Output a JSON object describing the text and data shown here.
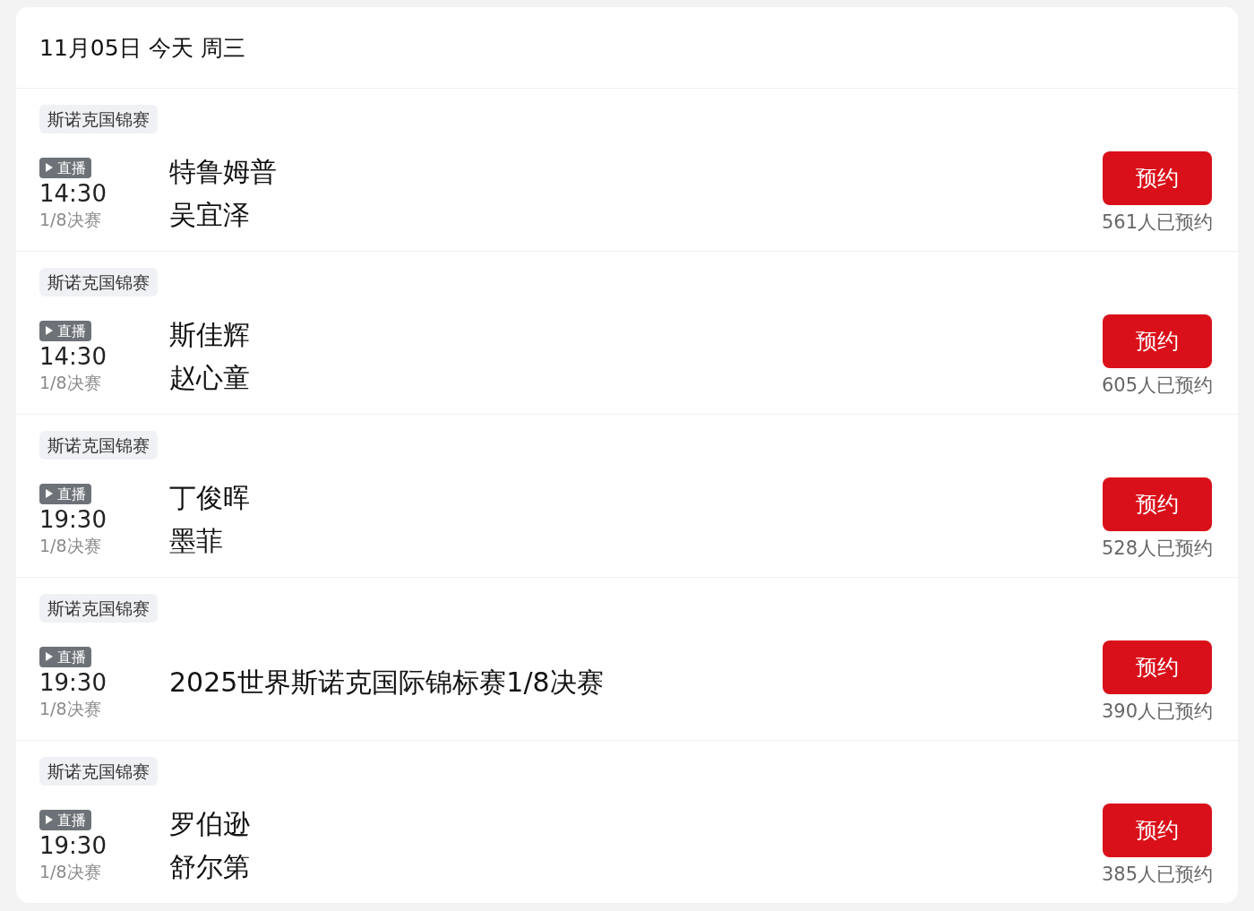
{
  "header": {
    "date": "11月05日",
    "day_label": "今天",
    "weekday": "周三"
  },
  "matches": [
    {
      "tag": "斯诺克国锦赛",
      "live_badge": "直播",
      "time": "14:30",
      "round": "1/8决赛",
      "lines": [
        "特鲁姆普",
        "吴宜泽"
      ],
      "button": "预约",
      "count": "561人已预约"
    },
    {
      "tag": "斯诺克国锦赛",
      "live_badge": "直播",
      "time": "14:30",
      "round": "1/8决赛",
      "lines": [
        "斯佳辉",
        "赵心童"
      ],
      "button": "预约",
      "count": "605人已预约"
    },
    {
      "tag": "斯诺克国锦赛",
      "live_badge": "直播",
      "time": "19:30",
      "round": "1/8决赛",
      "lines": [
        "丁俊晖",
        "墨菲"
      ],
      "button": "预约",
      "count": "528人已预约"
    },
    {
      "tag": "斯诺克国锦赛",
      "live_badge": "直播",
      "time": "19:30",
      "round": "1/8决赛",
      "lines": [
        "2025世界斯诺克国际锦标赛1/8决赛"
      ],
      "button": "预约",
      "count": "390人已预约"
    },
    {
      "tag": "斯诺克国锦赛",
      "live_badge": "直播",
      "time": "19:30",
      "round": "1/8决赛",
      "lines": [
        "罗伯逊",
        "舒尔第"
      ],
      "button": "预约",
      "count": "385人已预约"
    }
  ]
}
